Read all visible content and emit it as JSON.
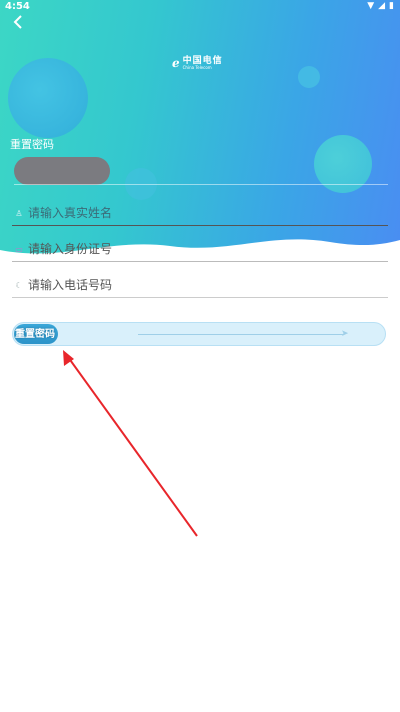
{
  "status_bar": {
    "time": "4:54",
    "icons": [
      "wifi-icon",
      "signal-icon",
      "battery-icon"
    ]
  },
  "nav": {
    "back_icon": "chevron-left-icon"
  },
  "logo": {
    "cn": "中国电信",
    "en": "China Telecom"
  },
  "page": {
    "heading": "重置密码"
  },
  "form": {
    "fields": [
      {
        "placeholder": "请输入真实姓名",
        "icon": "user-icon"
      },
      {
        "placeholder": "请输入身份证号",
        "icon": "id-card-icon"
      },
      {
        "placeholder": "请输入电话号码",
        "icon": "phone-icon"
      }
    ]
  },
  "slider": {
    "label": "重置密码",
    "direction_icon": "arrow-right-icon"
  },
  "colors": {
    "header_gradient_start": "#3cd7c5",
    "header_gradient_end": "#4a8df2",
    "slider_knob": "#2d94c9",
    "slider_track": "#d9f0fb",
    "annotation_arrow": "#e8262b"
  }
}
